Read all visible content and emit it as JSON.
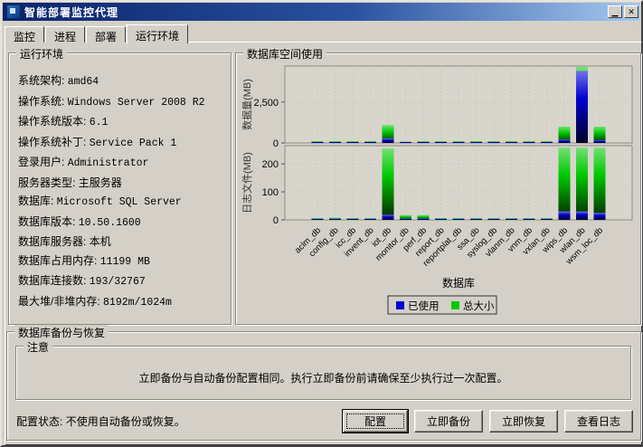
{
  "window": {
    "title": "智能部署监控代理",
    "minimize_glyph": "▁",
    "close_glyph": "✕"
  },
  "tabs": [
    {
      "label": "监控"
    },
    {
      "label": "进程"
    },
    {
      "label": "部署"
    },
    {
      "label": "运行环境"
    }
  ],
  "runtime": {
    "title": "运行环境",
    "rows": [
      {
        "label": "系统架构:",
        "value": "amd64"
      },
      {
        "label": "操作系统:",
        "value": "Windows Server 2008 R2"
      },
      {
        "label": "操作系统版本:",
        "value": "6.1"
      },
      {
        "label": "操作系统补丁:",
        "value": "Service Pack 1"
      },
      {
        "label": "登录用户:",
        "value": "Administrator"
      },
      {
        "label": "服务器类型:",
        "value": "主服务器"
      },
      {
        "label": "数据库:",
        "value": "Microsoft SQL Server"
      },
      {
        "label": "数据库版本:",
        "value": "10.50.1600"
      },
      {
        "label": "数据库服务器:",
        "value": "本机"
      },
      {
        "label": "数据库占用内存:",
        "value": "11199 MB"
      },
      {
        "label": "数据库连接数:",
        "value": "193/32767"
      },
      {
        "label": "最大堆/非堆内存:",
        "value": "8192m/1024m"
      }
    ]
  },
  "chart_panel": {
    "title": "数据库空间使用"
  },
  "chart_data": {
    "type": "bar",
    "title": "数据库空间使用",
    "xlabel": "数据库",
    "categories": [
      "aclm_db",
      "config_db",
      "icc_db",
      "invent_db",
      "iot_db",
      "monitor_db",
      "perf_db",
      "report_db",
      "reportplat_db",
      "ssa_db",
      "syslog_db",
      "vlanm_db",
      "vnm_db",
      "vxlan_db",
      "wips_db",
      "wlan_db",
      "wsm_loc_db"
    ],
    "legend": [
      {
        "name": "已使用",
        "color": "#0000d2"
      },
      {
        "name": "总大小",
        "color": "#00c800"
      }
    ],
    "legend_position": "bottom",
    "grid": true,
    "subplots": [
      {
        "ylabel": "数据量(MB)",
        "ylim": [
          0,
          4700
        ],
        "yticks": [
          0,
          2500
        ],
        "ytick_labels": [
          "0",
          "2,500"
        ],
        "series": [
          {
            "name": "已使用",
            "values": [
              15,
              50,
              15,
              60,
              270,
              30,
              40,
              10,
              20,
              10,
              20,
              40,
              10,
              20,
              200,
              4400,
              170
            ]
          },
          {
            "name": "总大小",
            "values": [
              30,
              60,
              30,
              70,
              1100,
              80,
              60,
              25,
              60,
              25,
              40,
              50,
              25,
              40,
              1000,
              4650,
              1000
            ]
          }
        ]
      },
      {
        "ylabel": "日志文件(MB)",
        "ylim": [
          0,
          265
        ],
        "yticks": [
          0,
          100,
          200
        ],
        "ytick_labels": [
          "0",
          "100",
          "200"
        ],
        "series": [
          {
            "name": "已使用",
            "values": [
              1,
              2,
              1,
              1,
              18,
              4,
              5,
              1,
              1,
              1,
              1,
              1,
              1,
              1,
              30,
              30,
              25
            ]
          },
          {
            "name": "总大小",
            "values": [
              2,
              8,
              2,
              3,
              255,
              17,
              17,
              2,
              2,
              2,
              4,
              3,
              2,
              4,
              258,
              258,
              258
            ]
          }
        ]
      }
    ]
  },
  "backup": {
    "title": "数据库备份与恢复",
    "note_title": "注意",
    "note_text": "立即备份与自动备份配置相同。执行立即备份前请确保至少执行过一次配置。",
    "status_label": "配置状态:",
    "status_value": "不使用自动备份或恢复。",
    "buttons": [
      {
        "label": "配置"
      },
      {
        "label": "立即备份"
      },
      {
        "label": "立即恢复"
      },
      {
        "label": "查看日志"
      }
    ]
  }
}
